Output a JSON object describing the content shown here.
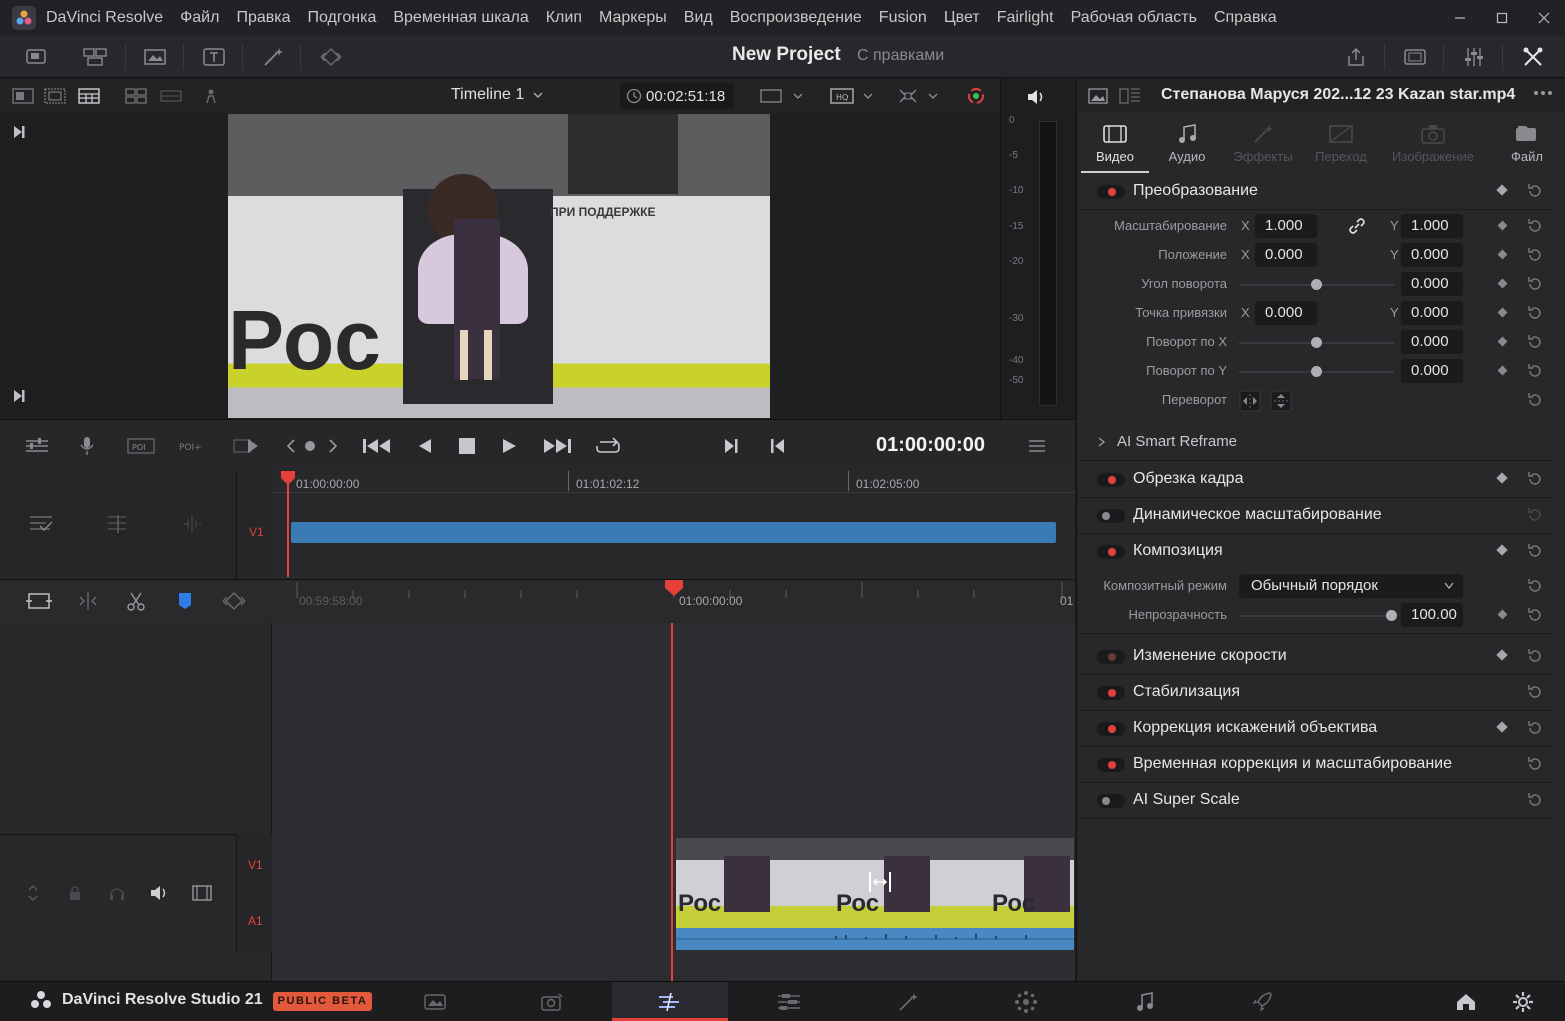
{
  "app": {
    "name": "DaVinci Resolve",
    "menu": [
      "Файл",
      "Правка",
      "Подгонка",
      "Временная шкала",
      "Клип",
      "Маркеры",
      "Вид",
      "Воспроизведение",
      "Fusion",
      "Цвет",
      "Fairlight",
      "Рабочая область",
      "Справка"
    ]
  },
  "toolbar": {
    "project_title": "New Project",
    "project_sub": "С правками"
  },
  "viewer": {
    "timeline_name": "Timeline 1",
    "timecode": "00:02:51:18",
    "meter_ticks": [
      "0",
      "-5",
      "-10",
      "-15",
      "-20",
      "-30",
      "-40",
      "-50"
    ],
    "frame_text": "Рос",
    "frame_banner": "ПРИ ПОДДЕРЖКЕ"
  },
  "transport": {
    "timecode": "01:00:00:00"
  },
  "timeline_upper": {
    "ruler": [
      "01:00:00:00",
      "01:01:02:12",
      "01:02:05:00"
    ],
    "track": "V1"
  },
  "timeline_lower": {
    "ruler": [
      "00:59:58:00",
      "01:00:00:00",
      "01"
    ],
    "tracks": [
      "V1",
      "A1"
    ],
    "clip_text": [
      "Рос",
      "Рос",
      "Рос"
    ]
  },
  "inspector": {
    "clip_name": "Степанова Маруся 202...12 23 Kazan star.mp4",
    "tabs": [
      {
        "label": "Видео",
        "icon": "film-icon"
      },
      {
        "label": "Аудио",
        "icon": "music-note-icon"
      },
      {
        "label": "Эффекты",
        "icon": "wand-icon"
      },
      {
        "label": "Переход",
        "icon": "transition-icon"
      },
      {
        "label": "Изображение",
        "icon": "camera-icon"
      },
      {
        "label": "Файл",
        "icon": "file-icon"
      }
    ],
    "transform": {
      "title": "Преобразование",
      "zoom_label": "Масштабирование",
      "zoom_x": "1.000",
      "zoom_y": "1.000",
      "position_label": "Положение",
      "position_x": "0.000",
      "position_y": "0.000",
      "rotation_label": "Угол поворота",
      "rotation": "0.000",
      "anchor_label": "Точка привязки",
      "anchor_x": "0.000",
      "anchor_y": "0.000",
      "pitch_label": "Поворот по X",
      "pitch": "0.000",
      "yaw_label": "Поворот по Y",
      "yaw": "0.000",
      "flip_label": "Переворот",
      "axis_x": "X",
      "axis_y": "Y"
    },
    "smart_reframe": "AI Smart Reframe",
    "cropping": "Обрезка кадра",
    "dynamic_zoom": "Динамическое масштабирование",
    "composite": {
      "title": "Композиция",
      "mode_label": "Композитный режим",
      "mode_value": "Обычный порядок",
      "opacity_label": "Непрозрачность",
      "opacity": "100.00"
    },
    "speed_change": "Изменение скорости",
    "stabilization": "Стабилизация",
    "lens_correction": "Коррекция искажений объектива",
    "retime_scaling": "Временная коррекция и масштабирование",
    "super_scale": "AI Super Scale"
  },
  "bottom": {
    "brand": "DaVinci Resolve Studio 21",
    "badge": "PUBLIC BETA"
  },
  "colors": {
    "accent_red": "#e5403a",
    "clip_blue": "#3b7bb4",
    "beta_orange": "#e3593b"
  }
}
